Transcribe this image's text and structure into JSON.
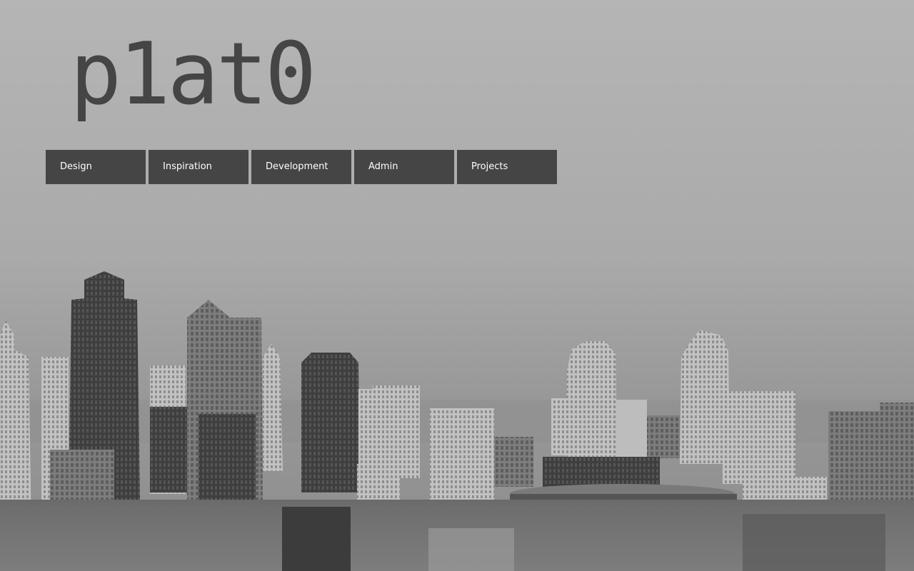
{
  "header": {
    "logo_text": "p1at0"
  },
  "nav": {
    "items": [
      {
        "label": "Design"
      },
      {
        "label": "Inspiration"
      },
      {
        "label": "Development"
      },
      {
        "label": "Admin"
      },
      {
        "label": "Projects"
      }
    ]
  },
  "background": {
    "kind": "city skyline photograph, grayscale",
    "colors": {
      "sky_top": "#b4b4b4",
      "sky_horizon": "#9c9c9c",
      "buildings_dark": "#3c3c3c",
      "buildings_light": "#bcbcbc",
      "nav_bg": "#454545",
      "logo": "#454545"
    }
  }
}
